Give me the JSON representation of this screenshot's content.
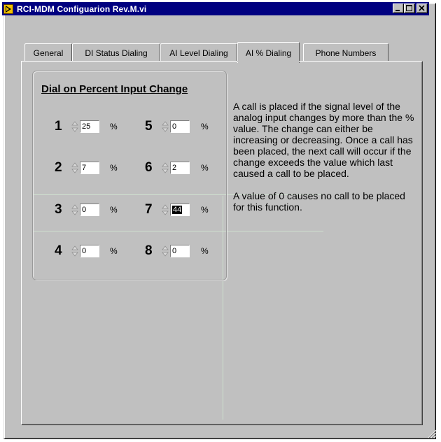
{
  "window": {
    "title": "RCI-MDM Configuarion Rev.M.vi"
  },
  "tabs": [
    {
      "label": "General"
    },
    {
      "label": "DI Status Dialing"
    },
    {
      "label": "AI Level Dialing"
    },
    {
      "label": "AI % Dialing"
    },
    {
      "label": "Phone Numbers"
    }
  ],
  "active_tab": "AI % Dialing",
  "group": {
    "title": "Dial on Percent Input Change",
    "channels": [
      {
        "label": "1",
        "value": "25",
        "unit": "%"
      },
      {
        "label": "2",
        "value": "7",
        "unit": "%"
      },
      {
        "label": "3",
        "value": "0",
        "unit": "%"
      },
      {
        "label": "4",
        "value": "0",
        "unit": "%"
      },
      {
        "label": "5",
        "value": "0",
        "unit": "%"
      },
      {
        "label": "6",
        "value": "2",
        "unit": "%"
      },
      {
        "label": "7",
        "value": "44",
        "unit": "%"
      },
      {
        "label": "8",
        "value": "0",
        "unit": "%"
      }
    ]
  },
  "description": {
    "paragraph1": "A call is placed if the signal level of the analog input changes by more than the % value.  The change can either be increasing or decreasing. Once a call has been placed, the next call will occur if the change exceeds the value which last caused a call to be placed.",
    "paragraph2": "A value of 0 causes no call to be placed for this function."
  },
  "colors": {
    "titlebar": "#000080",
    "face": "#c0c0c0",
    "app_icon": "#f2c200"
  },
  "icons": {
    "app": "labview-run-arrow-icon",
    "minimize": "minimize-icon",
    "maximize": "maximize-icon",
    "close": "close-icon",
    "spinner": "spinner-arrows-icon",
    "resize": "resize-grip-icon"
  }
}
